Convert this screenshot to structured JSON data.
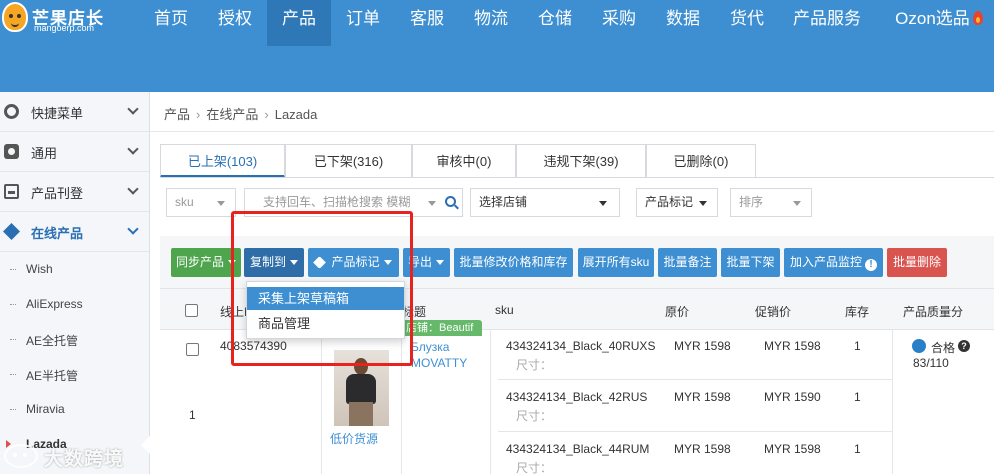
{
  "brand": {
    "name": "芒果店长",
    "domain": "mangoerp.com"
  },
  "nav": {
    "items": [
      "首页",
      "授权",
      "产品",
      "订单",
      "客服",
      "物流",
      "仓储",
      "采购",
      "数据",
      "货代",
      "产品服务",
      "Ozon选品"
    ],
    "active": "产品"
  },
  "sidebar": {
    "groups": [
      "快捷菜单",
      "通用",
      "产品刊登",
      "在线产品"
    ],
    "active_group": "在线产品",
    "sub_items": [
      "Wish",
      "AliExpress",
      "AE全托管",
      "AE半托管",
      "Miravia",
      "Lazada"
    ],
    "active_sub": "Lazada"
  },
  "breadcrumb": [
    "产品",
    "在线产品",
    "Lazada"
  ],
  "tabs": [
    "已上架(103)",
    "已下架(316)",
    "审核中(0)",
    "违规下架(39)",
    "已删除(0)"
  ],
  "active_tab": "已上架(103)",
  "filters": {
    "sku_select": "sku",
    "search_placeholder": "支持回车、扫描枪搜索  模糊",
    "store_select": "选择店铺",
    "mark_select": "产品标记",
    "sort_select": "排序"
  },
  "toolbar": {
    "sync": "同步产品",
    "copy_to": "复制到",
    "product_mark": "产品标记",
    "export": "导出",
    "bulk_price_stock": "批量修改价格和库存",
    "expand_sku": "展开所有sku",
    "bulk_note": "批量备注",
    "bulk_delist": "批量下架",
    "add_monitor": "加入产品监控",
    "bulk_delete": "批量删除"
  },
  "dropdown": {
    "items": [
      "采集上架草稿箱",
      "商品管理"
    ],
    "highlighted": "采集上架草稿箱"
  },
  "table": {
    "headers": [
      "线上I",
      "标题",
      "sku",
      "原价",
      "促销价",
      "库存",
      "产品质量分"
    ],
    "row": {
      "index": "1",
      "online_id": "4083574390",
      "image_caption": "低价货源",
      "title": "Блузка MOVATTY",
      "quality_label": "合格",
      "quality_score": "83/110",
      "tag": "店铺：Beautif",
      "skus": [
        {
          "sku": "434324134_Black_40RUXS",
          "attr": "尺寸：",
          "price": "MYR 1598",
          "promo": "MYR 1598",
          "stock": "1"
        },
        {
          "sku": "434324134_Black_42RUS",
          "attr": "尺寸：",
          "price": "MYR 1598",
          "promo": "MYR 1590",
          "stock": "1"
        },
        {
          "sku": "434324134_Black_44RUM",
          "attr": "尺寸：",
          "price": "MYR 1598",
          "promo": "MYR 1598",
          "stock": "1"
        }
      ]
    }
  },
  "watermark": "大数跨境",
  "colors": {
    "header": "#3d8fd2",
    "active_nav": "#2f78b8",
    "link": "#3d8fd2",
    "green_button": "#4ea54e",
    "red_button": "#d9534f",
    "annotation": "#e8231f"
  }
}
